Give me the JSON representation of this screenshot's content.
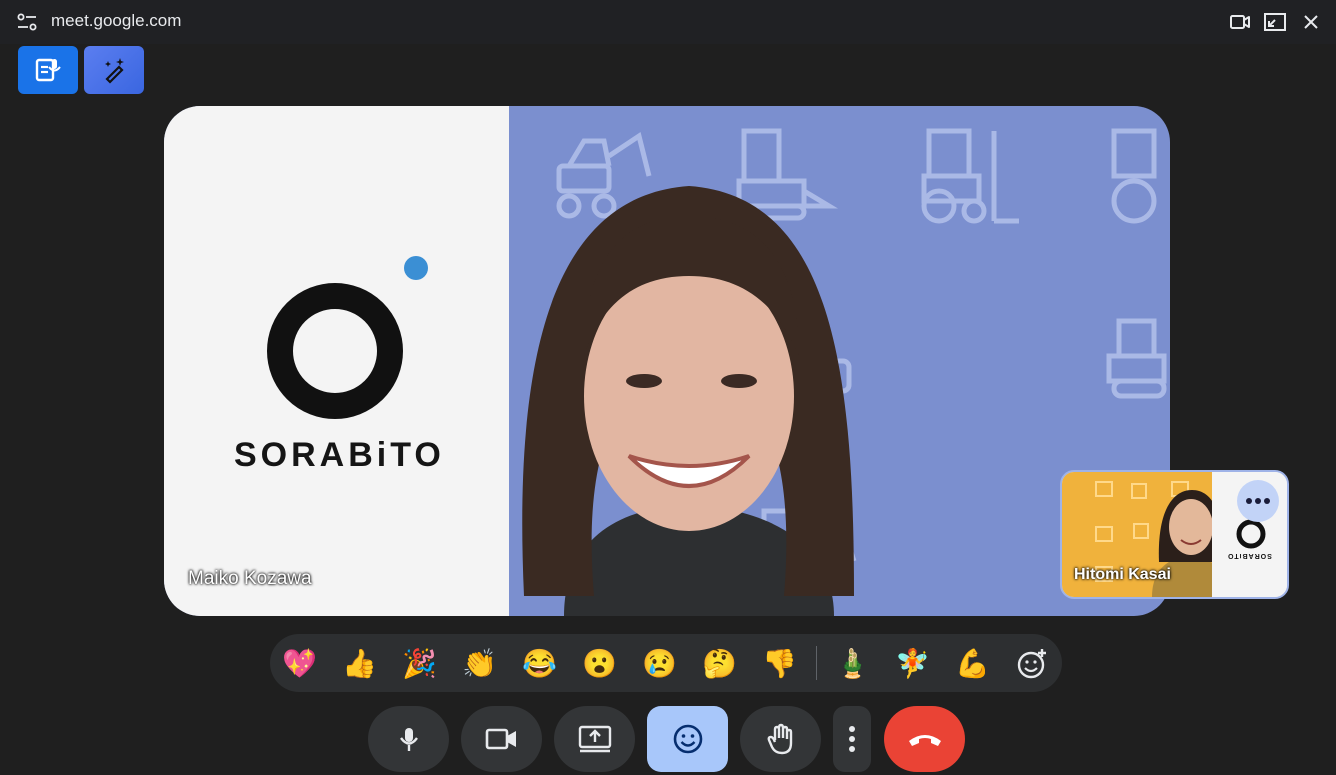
{
  "window": {
    "url": "meet.google.com",
    "site_info_icon": "site-settings-icon",
    "buttons": [
      "camera-icon",
      "picture-in-picture-icon",
      "close-icon"
    ]
  },
  "top_actions": [
    {
      "name": "transcript-button",
      "icon": "transcript-icon",
      "color": "#1a73e8"
    },
    {
      "name": "effects-button",
      "icon": "magic-pen-icon",
      "color": "#3f6fe0"
    }
  ],
  "main_tile": {
    "participant_name": "Maiko Kozawa",
    "brand_text": "SORABiTO",
    "brand_dot_color": "#3b8fd4",
    "background_color": "#7b8fcf"
  },
  "pip_tile": {
    "participant_name": "Hitomi Kasai",
    "brand_text": "SORABiTO",
    "more_button": "more-options-icon"
  },
  "reactions": [
    {
      "name": "sparkling-heart",
      "glyph": "💖"
    },
    {
      "name": "thumbs-up",
      "glyph": "👍"
    },
    {
      "name": "party-popper",
      "glyph": "🎉"
    },
    {
      "name": "clapping-hands",
      "glyph": "👏"
    },
    {
      "name": "tears-of-joy",
      "glyph": "😂"
    },
    {
      "name": "surprised",
      "glyph": "😮"
    },
    {
      "name": "crying",
      "glyph": "😢"
    },
    {
      "name": "thinking",
      "glyph": "🤔"
    },
    {
      "name": "thumbs-down",
      "glyph": "👎"
    },
    {
      "name": "kadomatsu",
      "glyph": "🎍"
    },
    {
      "name": "fairy",
      "glyph": "🧚"
    },
    {
      "name": "flexed-biceps",
      "glyph": "💪"
    },
    {
      "name": "add-reaction",
      "glyph": "add-reaction-icon"
    }
  ],
  "controls": [
    {
      "name": "microphone-button",
      "icon": "microphone-icon"
    },
    {
      "name": "camera-button",
      "icon": "video-camera-icon"
    },
    {
      "name": "present-button",
      "icon": "present-screen-icon"
    },
    {
      "name": "reactions-button",
      "icon": "smiley-icon",
      "active": true
    },
    {
      "name": "raise-hand-button",
      "icon": "hand-icon"
    },
    {
      "name": "more-options-button",
      "icon": "vertical-dots-icon"
    },
    {
      "name": "leave-call-button",
      "icon": "hang-up-icon",
      "color": "#ea4335"
    }
  ]
}
